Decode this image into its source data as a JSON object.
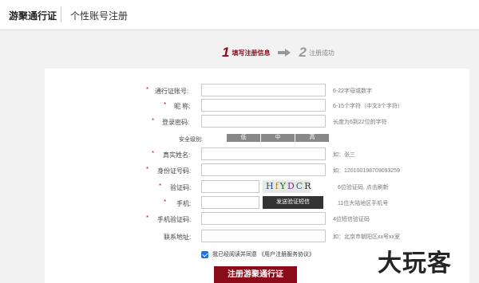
{
  "header": {
    "brand": "游聚通行证",
    "title": "个性账号注册"
  },
  "steps": [
    {
      "num": "1",
      "label": "填写注册信息"
    },
    {
      "num": "2",
      "label": "注册成功"
    }
  ],
  "form": {
    "account": {
      "label": "通行证账号:",
      "hint": "6-22字母或数字"
    },
    "nickname": {
      "label": "昵 称:",
      "hint": "6-15个字符（中文3个字符）"
    },
    "password": {
      "label": "登录密码:",
      "hint": "长度为6到22位的字符"
    },
    "security": {
      "label": "安全级别:",
      "levels": [
        "低",
        "中",
        "高"
      ]
    },
    "realname": {
      "label": "真实姓名:",
      "hint": "如：张三"
    },
    "idcard": {
      "label": "身份证号码:",
      "hint": "如：120100198709093259"
    },
    "captcha": {
      "label": "验证码:",
      "code": [
        "H",
        "f",
        "Y",
        "D",
        "C",
        "R"
      ],
      "hint": "6位验证码, 点击刷新"
    },
    "phone": {
      "label": "手机:",
      "button": "发送验证短信",
      "hint": "11位大陆地区手机号"
    },
    "sms": {
      "label": "手机验证码:",
      "hint": "4位短信验证码"
    },
    "address": {
      "label": "联系地址:",
      "hint": "如：北京市朝阳区xx号xx室"
    },
    "agree": {
      "text": "我已经阅读并同意",
      "link": "《用户注册服务协议》"
    },
    "submit": "注册游聚通行证"
  },
  "watermark": "大玩客"
}
